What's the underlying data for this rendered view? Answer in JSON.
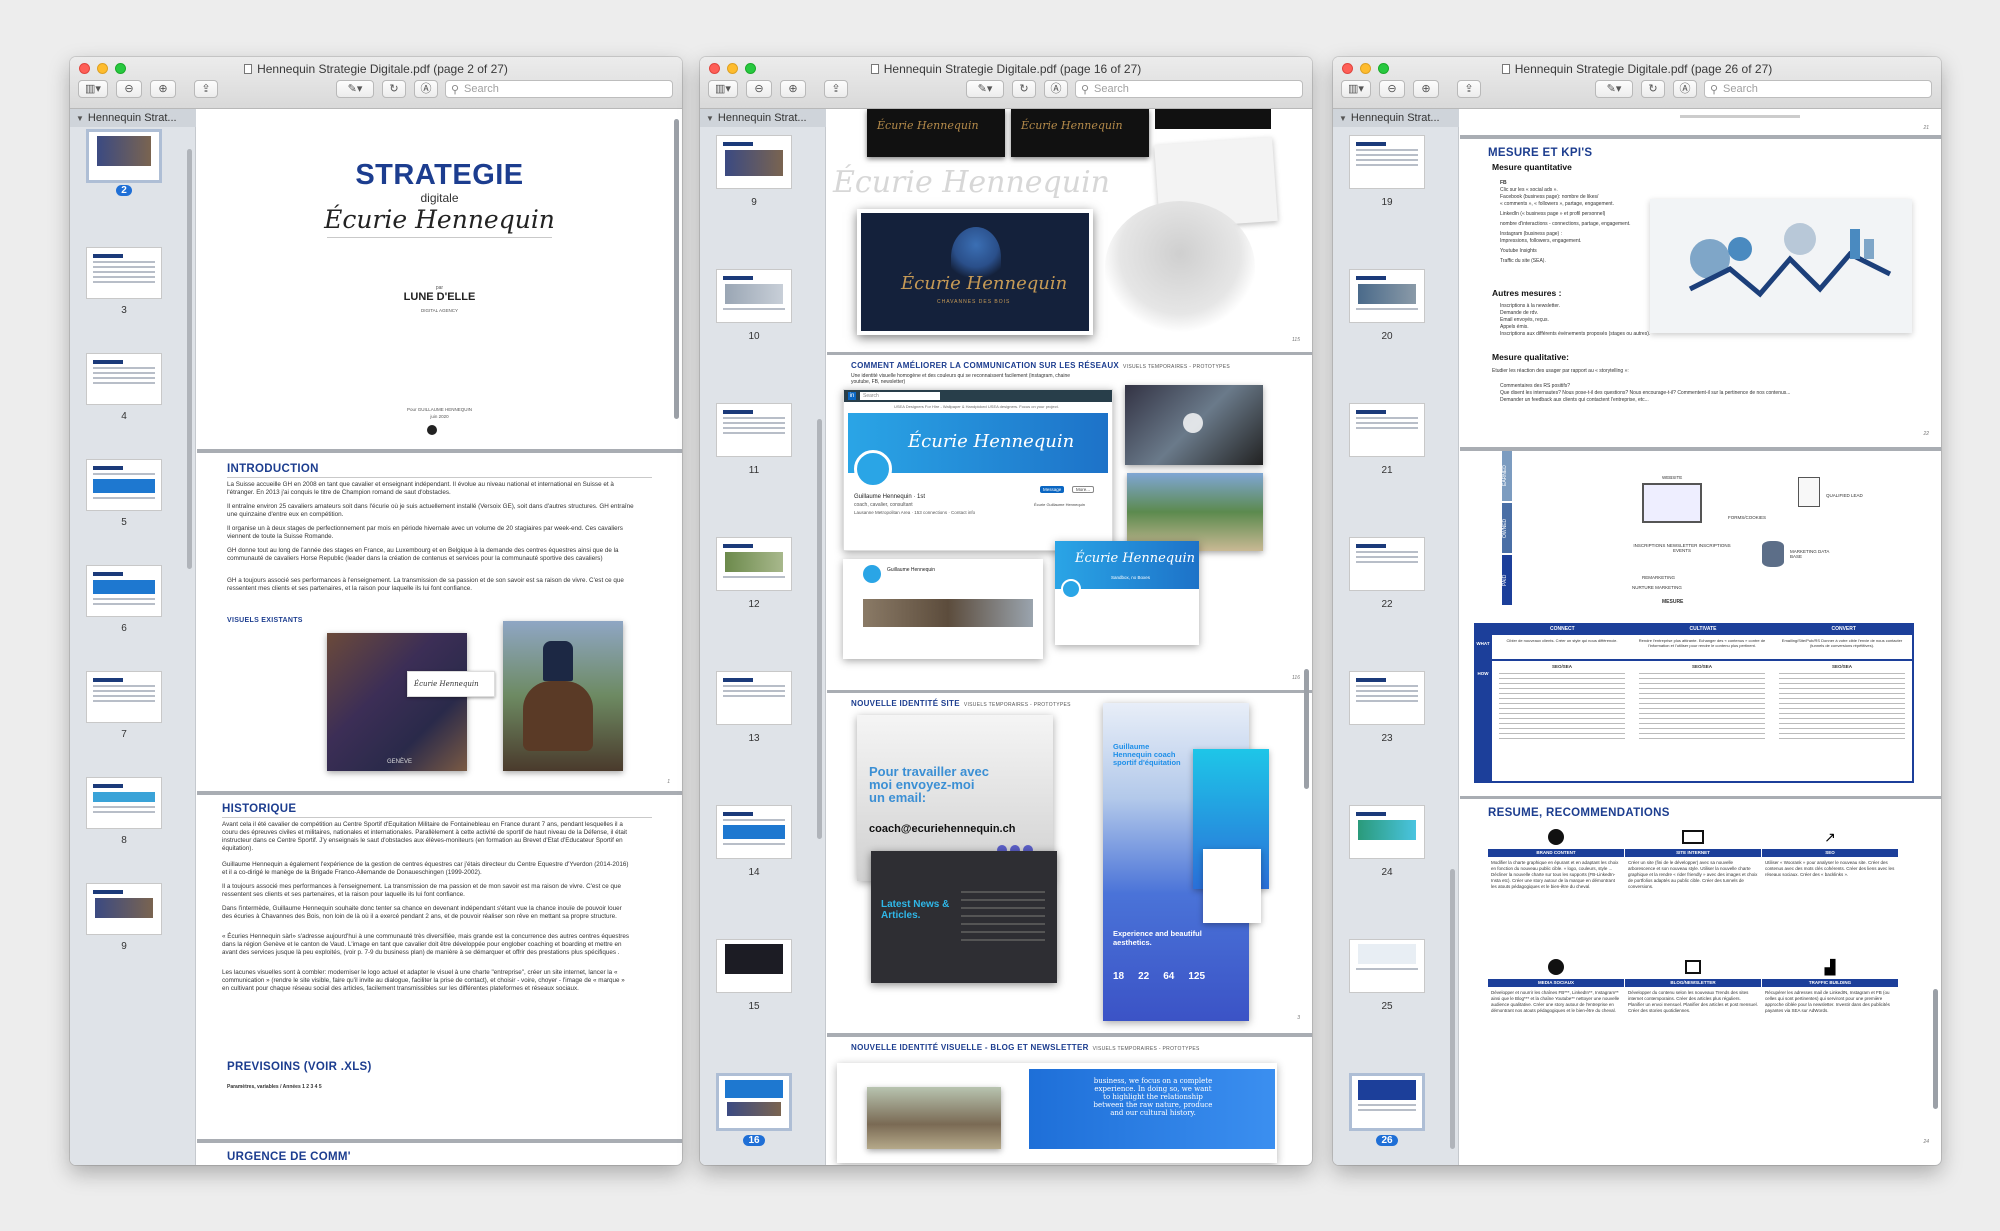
{
  "windows": [
    {
      "title": "Hennequin Strategie Digitale.pdf (page 2 of 27)",
      "search_placeholder": "Search",
      "sidebar_title": "Hennequin Strat...",
      "thumb_labels": [
        "2",
        "3",
        "4",
        "5",
        "6",
        "7",
        "8",
        "9"
      ]
    },
    {
      "title": "Hennequin Strategie Digitale.pdf (page 16 of 27)",
      "search_placeholder": "Search",
      "sidebar_title": "Hennequin Strat...",
      "thumb_labels": [
        "9",
        "10",
        "11",
        "12",
        "13",
        "14",
        "15",
        "16"
      ]
    },
    {
      "title": "Hennequin Strategie Digitale.pdf (page 26 of 27)",
      "search_placeholder": "Search",
      "sidebar_title": "Hennequin Strat...",
      "thumb_labels": [
        "19",
        "20",
        "21",
        "22",
        "23",
        "24",
        "25",
        "26"
      ]
    }
  ],
  "doc1": {
    "cover_title": "STRATEGIE",
    "cover_subtitle": "digitale",
    "cover_script": "Écurie Hennequin",
    "by": "par",
    "agency": "LUNE D'ELLE",
    "agency_sub": "DIGITAL AGENCY",
    "for_line": "Pour GUILLAUME HENNEQUIN",
    "date_line": "juin 2020",
    "intro_title": "INTRODUCTION",
    "intro_p1": "La Suisse accueille GH en 2008 en tant que cavalier et enseignant indépendant. Il évolue au niveau national et international en Suisse et à l'étranger. En 2013 j'ai conquis le titre de Champion romand de saut d'obstacles.",
    "intro_p2": "Il entraîne environ 25 cavaliers amateurs soit dans l'écurie où je suis actuellement installé (Versoix GE), soit dans d'autres structures. GH entraîne une quinzaine d'entre eux en compétition.",
    "intro_p3": "Il organise un à deux stages de perfectionnement par mois en période hivernale avec un volume de 20 stagiaires par week-end. Ces cavaliers viennent de toute la Suisse Romande.",
    "intro_p4": "GH donne tout au long de l'année des stages en France, au Luxembourg et en Belgique à la demande des centres équestres ainsi que de la communauté de cavaliers Horse Republic (leader dans la création de contenus et services pour la communauté sportive des cavaliers)",
    "intro_p5": "GH a toujours associé ses performances à l'enseignement. La transmission de sa passion et de son savoir est sa raison de vivre. C'est ce que ressentent mes clients et ses partenaires, et la raison pour laquelle ils lui font confiance.",
    "visuels_title": "VISUELS EXISTANTS",
    "logo_tag": "Écurie Hennequin",
    "brand_tag": "GENÈVE",
    "page_num_a": "1",
    "historique_title": "HISTORIQUE",
    "hist_p1": "Avant cela il été cavalier de compétition au Centre Sportif d'Equitation Militaire de Fontainebleau en France durant 7 ans, pendant lesquelles il a couru des épreuves civiles et militaires, nationales et internationales. Parallèlement à cette activité de sportif de haut niveau de la Défense, il était instructeur dans ce Centre Sportif. J'y enseignais le saut d'obstacles aux élèves-moniteurs (en formation au Brevet d'Etat d'Educateur Sportif en équitation).",
    "hist_p2": "Guillaume Hennequin a également l'expérience de la gestion de centres équestres car j'étais directeur du Centre Equestre d'Yverdon (2014-2016) et il a co-dirigé le manège de la Brigade Franco-Allemande de Donaueschingen (1999-2002).",
    "hist_p3": "Il a toujours associé mes performances à l'enseignement. La transmission de ma passion et de mon savoir est ma raison de vivre. C'est ce que ressentent ses clients et ses partenaires, et la raison pour laquelle ils lui font confiance.",
    "hist_p4": "Dans l'intermède, Guillaume Hennequin souhaite donc tenter sa chance en devenant indépendant s'étant vue la chance inouïe de pouvoir louer des écuries à Chavannes des Bois, non loin de là où il a exercé pendant 2 ans, et de pouvoir réaliser son rêve en mettant sa propre structure.",
    "hist_p5": "« Écuries Hennequin sàrl» s'adresse aujourd'hui à une communauté très diversifiée, mais grande est la concurrence des autres centres équestres dans la région Genève et le canton de Vaud. L'image en tant que cavalier doit être développée pour englober coaching et boarding et mettre en avant des services jusque là peu exploités, (voir p. 7-9 du business plan) de manière à se démarquer et offrir des prestations plus spécifiques .",
    "hist_p6": "Les lacunes visuelles sont à combler: moderniser le logo actuel et adapter le visuel à une charte \"entreprise\", créer un site internet, lancer la « communication » (rendre le site visible, faire qu'il invite au dialogue, faciliter la prise de contact), et choisir - voire, choyer - l'image de « marque » en cultivant pour chaque réseau social des articles, facilement transmissibles sur les différentes plateformes et réseaux sociaux.",
    "page_num_b": "2",
    "previsions_title": "PREVISOINS (VOIR .XLS)",
    "previsions_row": "Paramètres, variables / Années 1   2   3   4   5",
    "urgence_title": "URGENCE DE COMM'"
  },
  "doc2": {
    "brand_script": "Écurie Hennequin",
    "brand_tag": "CHAVANNES DES BOIS",
    "page_num_a": "115",
    "comm_title": "COMMENT AMÉLIORER LA COMMUNICATION SUR LES RÉSEAUX",
    "comm_tag": "VISUELS TEMPORAIRES - PROTOTYPES",
    "comm_desc": "Une identité visuelle homogène et des couleurs qui se reconnaissent facilement (instagram, chaine youtube, FB, newsletter)",
    "li_search": "Search",
    "li_banner": "USEA Designers For Hire - Wallpaper & Handpicked USEA designers. Focus on your project.",
    "li_name": "Guillaume Hennequin · 1st",
    "li_role": "coach, cavalier, consultant",
    "li_loc": "Lausanne Metropolitan Area · 153 connections · Contact info",
    "li_message": "Message",
    "li_more": "More...",
    "li_company": "Écurie Guillaume Hennequin",
    "fb_name": "Guillaume Hennequin",
    "fb_sub": "Sandbox, no Boxes",
    "page_num_b": "116",
    "site_title": "NOUVELLE IDENTITÉ SITE",
    "site_tag": "VISUELS TEMPORAIRES - PROTOTYPES",
    "site_cta": "Pour travailler avec moi envoyez-moi un email:",
    "site_email": "coach@ecuriehennequin.ch",
    "site_news": "Latest News & Articles.",
    "site_coach": "Guillaume Hennequin coach sportif d'équitation",
    "site_exp": "Experience and beautiful aesthetics.",
    "stats": [
      "18",
      "22",
      "64",
      "125"
    ],
    "page_num_c": "3",
    "blog_title": "NOUVELLE IDENTITÉ VISUELLE - BLOG ET NEWSLETTER",
    "blog_tag": "VISUELS TEMPORAIRES - PROTOTYPES",
    "blog_quote": "business, we focus on a complete experience. In doing so, we want to highlight the relationship between the raw nature, produce and our cultural history."
  },
  "doc3": {
    "page_num_top": "21",
    "kpi_title": "MESURE ET KPI'S",
    "kpi_quant": "Mesure quantitative",
    "kpi_fb": "FB",
    "kpi_lines": [
      "Clic sur les « social ads ».",
      "Facebook (business page): nombre de likes/",
      "« comments », « followers », partage, engagement.",
      "LinkedIn (« business page » et profil personnel)",
      "nombre d'interactions - connections, partage, engagement.",
      "Instagram (business page) :",
      "Impressions, followers, engagement.",
      "Youtube Insights",
      "Traffic du site (SEA)."
    ],
    "kpi_other": "Autres mesures :",
    "kpi_other_lines": [
      "Inscriptions à la newsletter.",
      "Demande de rdv.",
      "Email envoyés, reçus.",
      "Appels émis.",
      "Inscriptions aux différents événements proposés (stages ou autres)."
    ],
    "kpi_qual": "Mesure qualitative:",
    "kpi_qual_intro": "Etudier les réaction des usager par rapport au « storytelling »:",
    "kpi_qual_lines": [
      "Commentaires des RS positifs?",
      "Que disent les internautes? Nous pose-t-il des questions? Nous encourage-t-il? Commentent-il sur la pertinence de nos contenus...",
      "Demander un feedback aux clients qui contactent l'entreprise, etc..."
    ],
    "page_num_a": "22",
    "funnel_earned": "EARNED",
    "funnel_owned": "OWNED",
    "funnel_paid": "PAID",
    "funnel_website": "WEBSITE",
    "funnel_forms": "FORMS/COOKIES",
    "funnel_qualified": "QUALIFIED LEAD",
    "funnel_inscriptions": "INSCRIPTIONS NEWSLETTER INSCRIPTIONS EVENTS",
    "funnel_marketing": "MARKETING DATA BASE",
    "funnel_remarketing": "REMARKETING",
    "funnel_nurture": "NURTURE MARKETING",
    "funnel_mesure": "MESURE",
    "table_cols": [
      "CONNECT",
      "CULTIVATE",
      "CONVERT"
    ],
    "table_rows": [
      "WHAT",
      "HOW"
    ],
    "table_what": [
      "Cibler de nouveaux clients. Créer un style qui nous différencie.",
      "Rendre l'entreprise plus attirante. Echanger des « contenus » contre de l'information et l'utiliser pour rendre le contenu plus pertinent.",
      "Emailing/Site/Pub/RS Donner à votre cible l'envie de nous contacter (tunnels de conversions répétitives)."
    ],
    "table_how_heads": [
      "SEO/SEA",
      "SEO/SEA",
      "SEO/SEA"
    ],
    "resume_title": "RESUME, RECOMMENDATIONS",
    "rec_heads": [
      "BRAND CONTENT",
      "SITE INTERNET",
      "SEO",
      "MEDIA SOCIAUX",
      "BLOG/NEWSLETTER",
      "TRAFFIC BUILDING"
    ],
    "rec_col1": "Modifier la charte graphique en épurant et en adaptant les choix en fonction du nouveau public cible. « logo, couleurs, style ... Décliner la nouvelle charte sur tous les supports (FB-LinkedIn-Insta etc). Créer une story autour de la marque en démontrant les atouts pédagogiques et le bien-être du cheval.",
    "rec_col2": "Créer un site (fini de le développer) avec sa nouvelle arborescence et son nouveau style. Utiliser la nouvelle charte graphique et la rendre « rider friendly » avec des images et choix de portfolios adaptés au public cible. Créer des tunnels de conversions.",
    "rec_col3": "Utiliser « Woorank » pour analyser le nouveau site. Créer des contenus avec des mots clés cohérents. Créer des liens avec les réseaux sociaux. Créer des « backlinks ».",
    "rec_col4": "Développer et nourrir les chaînes FB***, LinkedIn**, Instagram** ainsi que le Blog*** et la chaîne Youtube** nettoyer une nouvelle audience qualitative. Créer une story autour de l'entreprise en démontrant nos atouts pédagogiques et le bien-être du cheval.",
    "rec_col5": "Développer du contenu selon les nouveaux Trends des sites internet contemporains. Créer des articles plus réguliers. Planifier un envoi mensuel. Planifier des articles et post mensuel. Créer des stories quotidiennes.",
    "rec_col6": "Récupérer les adresses mail de LinkedIN, Instagram et FB (ou celles qui sont pertinentes) qui serviront pour une première approche ciblée pour la newsletter. Investir dans des publicités payantes via SEA sur AdWords.",
    "page_num_b": "24"
  }
}
